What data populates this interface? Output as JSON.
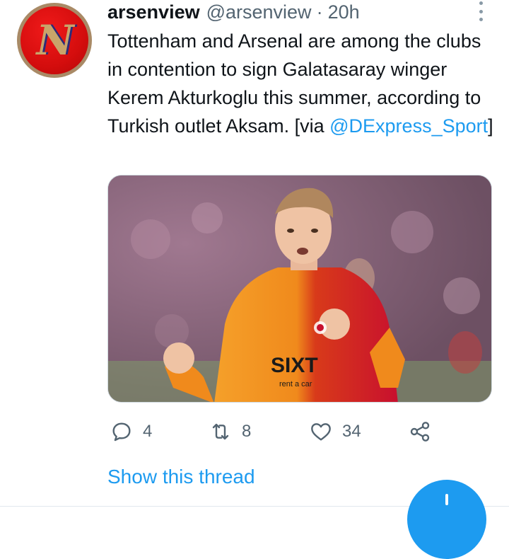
{
  "tweet": {
    "author_name": "arsenview",
    "author_handle": "@arsenview",
    "separator": "·",
    "timestamp": "20h",
    "avatar_letter": "N",
    "text_before_mention": "Tottenham and Arsenal are among the clubs in contention to sign Galatasaray winger Kerem Akturkoglu this summer, according to Turkish outlet Aksam. [via ",
    "mention": "@DExpress_Sport",
    "text_after_mention": "]",
    "jersey_sponsor": "SIXT",
    "jersey_sponsor_sub": "rent a car"
  },
  "actions": {
    "reply_count": "4",
    "retweet_count": "8",
    "like_count": "34"
  },
  "thread": {
    "show_thread_label": "Show this thread"
  },
  "colors": {
    "accent": "#1d9bf0",
    "secondary_text": "#536471",
    "primary_text": "#0f1419",
    "galatasaray_orange": "#f08a1c",
    "galatasaray_red": "#c8102e"
  },
  "icons": [
    "more-icon",
    "reply-icon",
    "retweet-icon",
    "like-icon",
    "share-icon",
    "compose-icon"
  ]
}
